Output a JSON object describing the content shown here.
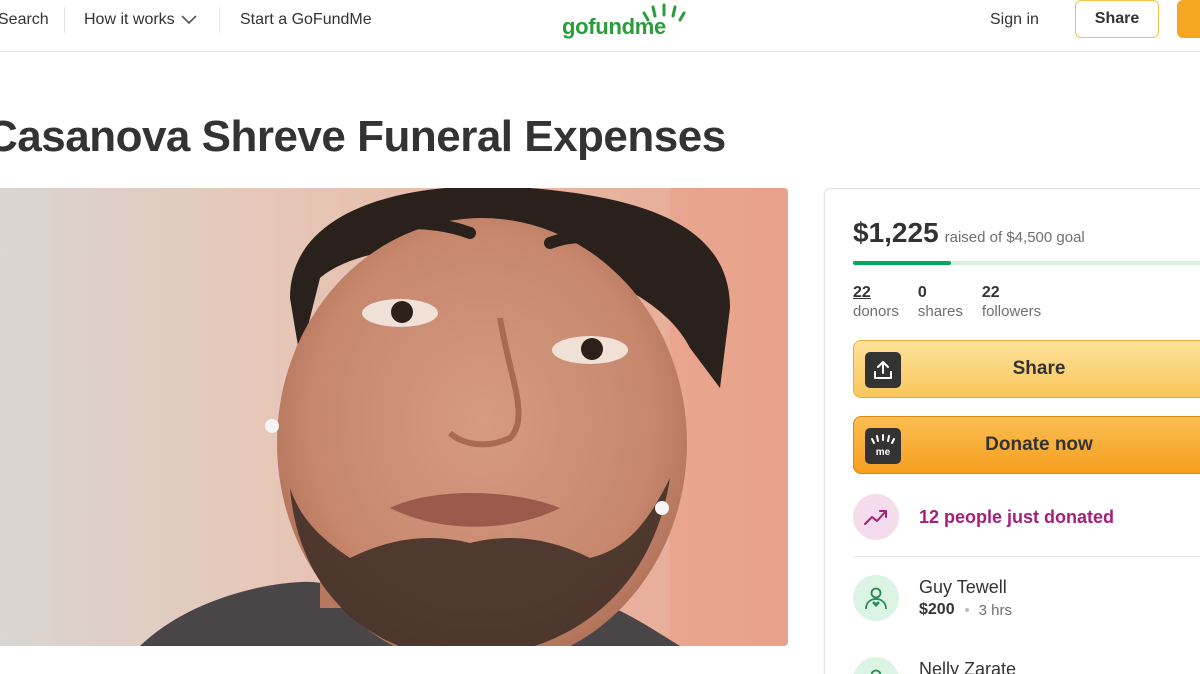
{
  "nav": {
    "search_label": "Search",
    "how_it_works_label": "How it works",
    "start_label": "Start a GoFundMe",
    "logo_text": "gofundme",
    "signin_label": "Sign in",
    "share_label": "Share"
  },
  "campaign": {
    "title": "Casanova Shreve Funeral Expenses",
    "raised_amount": "$1,225",
    "raised_goal_text": "raised of $4,500 goal",
    "progress_fraction": 0.272,
    "stats": [
      {
        "value": "22",
        "label": "donors"
      },
      {
        "value": "0",
        "label": "shares"
      },
      {
        "value": "22",
        "label": "followers"
      }
    ],
    "share_button_label": "Share",
    "donate_button_label": "Donate now",
    "icon_badge_text": "me",
    "trending_text": "12 people just donated"
  },
  "donations": [
    {
      "name": "Guy Tewell",
      "amount": "$200",
      "time": "3 hrs"
    },
    {
      "name": "Nelly Zarate",
      "amount": "",
      "time": ""
    }
  ],
  "colors": {
    "brand_green": "#02a95c",
    "donate_orange": "#f59f1e",
    "share_yellow": "#f9c65a",
    "trending_purple": "#a41e7a"
  }
}
